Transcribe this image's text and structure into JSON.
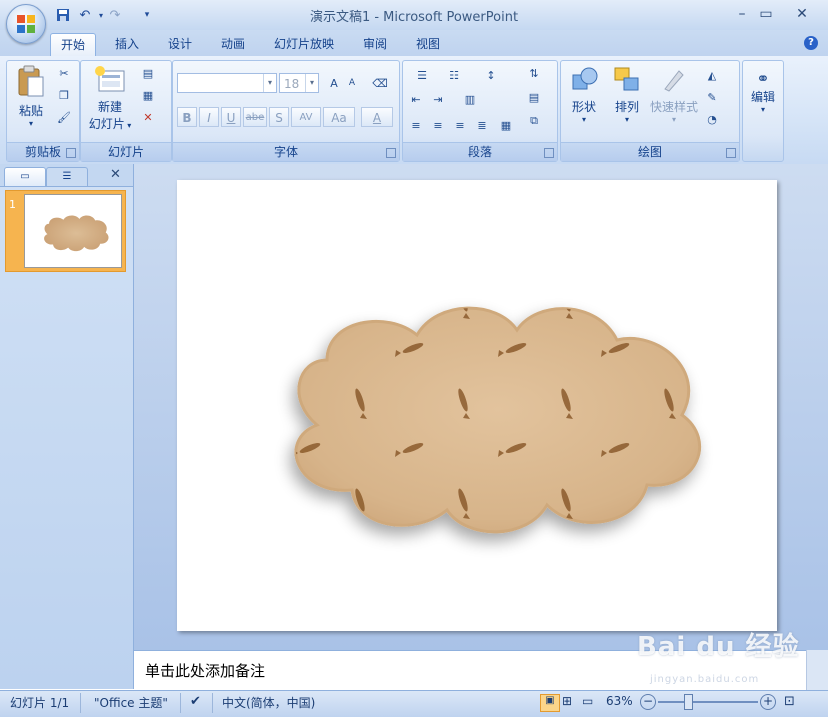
{
  "window": {
    "title": "演示文稿1 - Microsoft PowerPoint",
    "minimize_glyph": "–",
    "maximize_glyph": "▭",
    "close_glyph": "✕"
  },
  "qat": {
    "undo_icon": "undo-icon",
    "redo_icon": "redo-icon",
    "save_icon": "save-icon",
    "customize_glyph": "▾"
  },
  "tabs": [
    {
      "label": "开始"
    },
    {
      "label": "插入"
    },
    {
      "label": "设计"
    },
    {
      "label": "动画"
    },
    {
      "label": "幻灯片放映"
    },
    {
      "label": "审阅"
    },
    {
      "label": "视图"
    }
  ],
  "help_glyph": "?",
  "ribbon": {
    "clipboard": {
      "paste_label": "粘贴",
      "group_label": "剪贴板"
    },
    "slides": {
      "new_slide_label_1": "新建",
      "new_slide_label_2": "幻灯片",
      "group_label": "幻灯片"
    },
    "font": {
      "font_name": "",
      "font_size": "18",
      "group_label": "字体",
      "bold": "B",
      "italic": "I",
      "underline": "U",
      "strike": "abe",
      "shadow": "S",
      "spacing": "AV",
      "case": "Aa",
      "color": "A",
      "grow": "A",
      "shrink": "A"
    },
    "paragraph": {
      "group_label": "段落"
    },
    "drawing": {
      "shapes_label": "形状",
      "arrange_label": "排列",
      "quick_styles_label": "快速样式",
      "group_label": "绘图"
    },
    "editing": {
      "label": "编辑"
    }
  },
  "slides_pane": {
    "thumb_number": "1",
    "close_glyph": "✕"
  },
  "notes": {
    "placeholder": "单击此处添加备注"
  },
  "status": {
    "slide_info": "幻灯片 1/1",
    "theme": "\"Office 主题\"",
    "language": "中文(简体，中国)",
    "zoom": "63%"
  },
  "watermark": {
    "brand": "Bai du 经验",
    "sub": "jingyan.baidu.com"
  },
  "colors": {
    "accent": "#15428b",
    "ribbon": "#d5e4f7",
    "shape_fill": "#d9b68d"
  }
}
